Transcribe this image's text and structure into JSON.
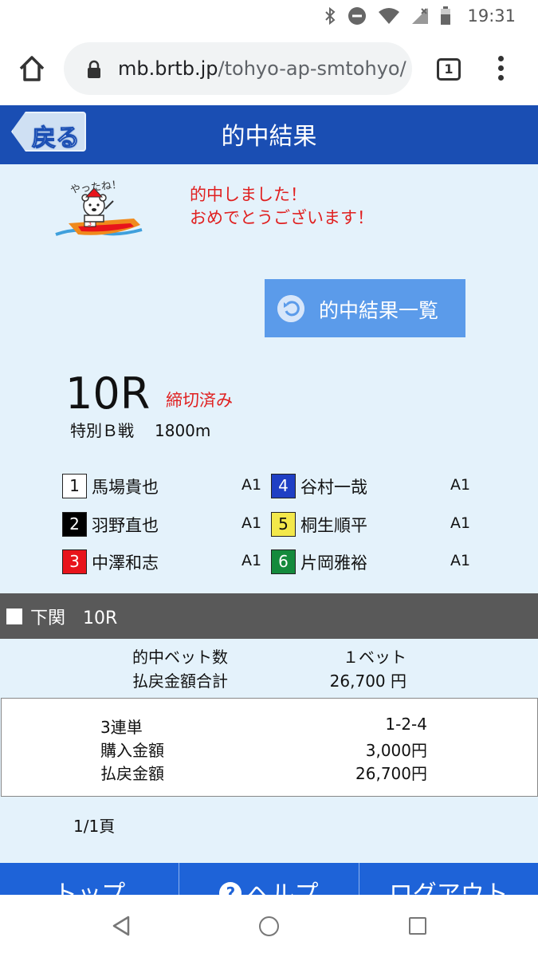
{
  "status_bar": {
    "time": "19:31"
  },
  "browser": {
    "url_domain": "mb.brtb.jp",
    "url_path": "/tohyo-ap-smtohyo/",
    "tab_count": "1"
  },
  "header": {
    "back_label": "戻る",
    "title": "的中結果"
  },
  "mascot": {
    "caption": "やったね！",
    "boat_number": "3"
  },
  "congrats": {
    "line1": "的中しました！",
    "line2": "おめでとうございます！"
  },
  "results_list_button": "的中結果一覧",
  "race": {
    "number": "10R",
    "status": "締切済み",
    "name": "特別Ｂ戦",
    "distance": "1800m"
  },
  "racers": [
    {
      "num": "1",
      "name": "馬場貴也",
      "class": "A1",
      "bg": "#ffffff",
      "fg": "#111111"
    },
    {
      "num": "2",
      "name": "羽野直也",
      "class": "A1",
      "bg": "#000000",
      "fg": "#ffffff"
    },
    {
      "num": "3",
      "name": "中澤和志",
      "class": "A1",
      "bg": "#e8141b",
      "fg": "#ffffff"
    },
    {
      "num": "4",
      "name": "谷村一哉",
      "class": "A1",
      "bg": "#1f3fc4",
      "fg": "#ffffff"
    },
    {
      "num": "5",
      "name": "桐生順平",
      "class": "A1",
      "bg": "#f3e84a",
      "fg": "#111111"
    },
    {
      "num": "6",
      "name": "片岡雅裕",
      "class": "A1",
      "bg": "#148a3c",
      "fg": "#ffffff"
    }
  ],
  "venue": {
    "label": "下関　10R"
  },
  "summary": {
    "hit_bets_label": "的中ベット数",
    "hit_bets_value": "１ベット",
    "payout_total_label": "払戻金額合計",
    "payout_total_value": "26,700 円"
  },
  "detail": {
    "bet_type_label": "3連単",
    "bet_combo": "1-2-4",
    "purchase_label": "購入金額",
    "purchase_value": "3,000円",
    "payout_label": "払戻金額",
    "payout_value": "26,700円"
  },
  "pager": "1/1頁",
  "footer_nav": {
    "top": "トップ",
    "help": "ヘルプ",
    "logout": "ログアウト"
  }
}
